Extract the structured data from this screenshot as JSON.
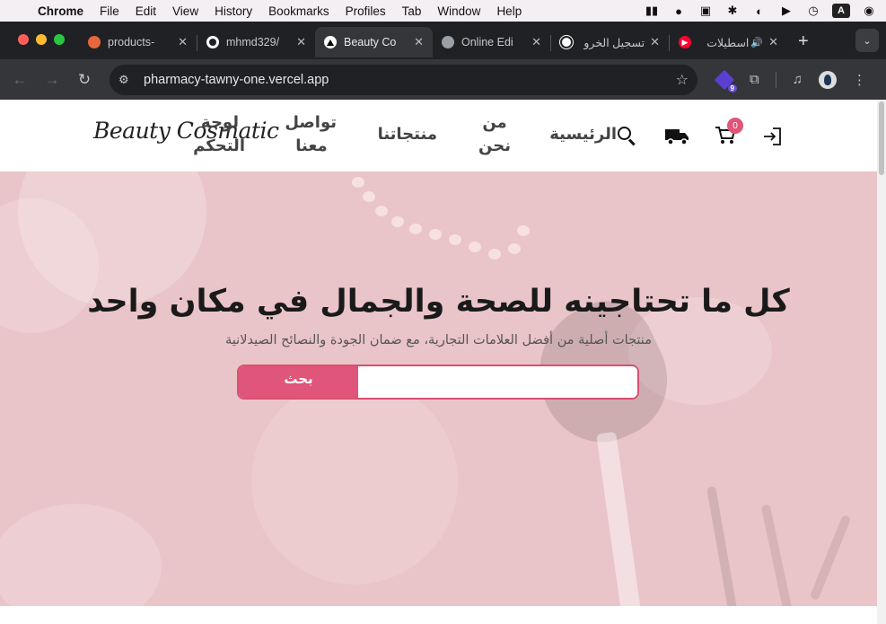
{
  "menubar": {
    "app": "Chrome",
    "items": [
      "File",
      "Edit",
      "View",
      "History",
      "Bookmarks",
      "Profiles",
      "Tab",
      "Window",
      "Help"
    ],
    "status_letter": "A"
  },
  "tabs": [
    {
      "title": "products-",
      "favicon": "orange-diamond-icon",
      "color": "#e8663d",
      "active": false
    },
    {
      "title": "mhmd329/",
      "favicon": "github-icon",
      "color": "#ffffff",
      "active": false
    },
    {
      "title": "Beauty Co",
      "favicon": "vercel-triangle-icon",
      "color": "#000000",
      "active": true
    },
    {
      "title": "Online Edi",
      "favicon": "globe-icon",
      "color": "#9aa0a6",
      "active": false
    },
    {
      "title": "تسجيل الخرو",
      "favicon": "openai-icon",
      "color": "#ffffff",
      "active": false
    },
    {
      "title": "اسطيلات",
      "favicon": "youtube-icon",
      "color": "#ff0033",
      "active": false
    }
  ],
  "toolbar": {
    "url": "pharmacy-tawny-one.vercel.app",
    "extension_badge": "9"
  },
  "site": {
    "logo": "Beauty Cosmatic",
    "nav": {
      "home": "الرئيسية",
      "about": "من نحن",
      "products": "منتجاتنا",
      "contact": "تواصل معنا",
      "dashboard": "لوحة التحكم"
    },
    "cart_count": "0"
  },
  "hero": {
    "title": "كل ما تحتاجينه للصحة والجمال في مكان واحد",
    "subtitle": "منتجات أصلية من أفضل العلامات التجارية، مع ضمان الجودة والنصائح الصيدلانية",
    "search_button": "بحث",
    "search_placeholder": "",
    "accent": "#e0557a",
    "background": "#e9c4c8"
  }
}
